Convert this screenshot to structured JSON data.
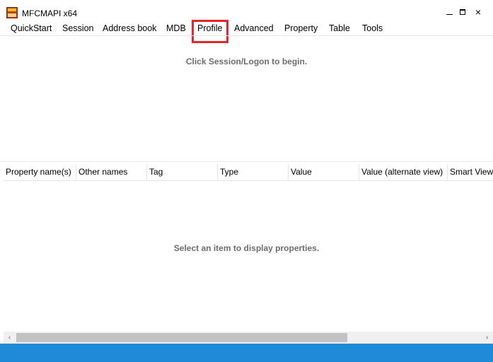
{
  "window": {
    "title": "MFCMAPI x64",
    "icon": "mfcmapi-app-icon",
    "controls": {
      "minimize": "minimize-icon",
      "maximize": "maximize-icon",
      "close": "×"
    }
  },
  "menu": {
    "items": [
      "QuickStart",
      "Session",
      "Address book",
      "MDB",
      "Profile",
      "Advanced",
      "Property",
      "Table",
      "Tools"
    ],
    "highlighted": "Profile",
    "highlight_color": "#e8262a"
  },
  "upper_pane": {
    "message": "Click Session/Logon to begin."
  },
  "property_list": {
    "columns": [
      "Property name(s)",
      "Other names",
      "Tag",
      "Type",
      "Value",
      "Value (alternate view)",
      "Smart View"
    ],
    "empty_message": "Select an item to display properties."
  },
  "scrollbar": {
    "left_arrow": "‹",
    "right_arrow": "›"
  },
  "colors": {
    "taskbar": "#1f8ad8",
    "message_text": "#6d6d6d"
  }
}
